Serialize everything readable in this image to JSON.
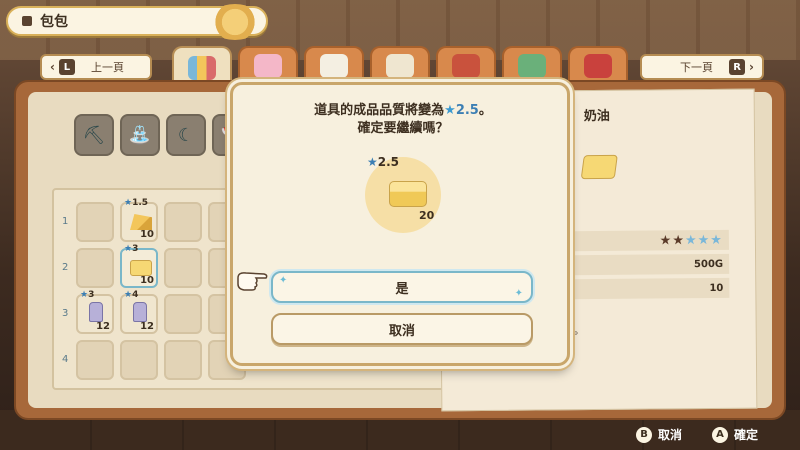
{
  "header": {
    "title": "包包",
    "menu_icon": "menu-list-icon",
    "emblem_icon": "rope-emblem-icon"
  },
  "tabs": {
    "prev": {
      "label": "上一頁",
      "key": "L"
    },
    "next": {
      "label": "下一頁",
      "key": "R"
    },
    "items": [
      {
        "icon": "bag-icon",
        "active": true
      },
      {
        "icon": "gift-icon",
        "active": false
      },
      {
        "icon": "letter-icon",
        "active": false
      },
      {
        "icon": "envelope-icon",
        "active": false
      },
      {
        "icon": "shop-icon",
        "active": false
      },
      {
        "icon": "book-icon",
        "active": false
      },
      {
        "icon": "calendar-icon",
        "active": false
      }
    ]
  },
  "tools": [
    "pickaxe-icon",
    "watering-can-icon",
    "sickle-icon",
    "axe-icon"
  ],
  "grid": {
    "rows": [
      "1",
      "2",
      "3",
      "4"
    ],
    "items": [
      {
        "name": "cheese",
        "grade": "1.5",
        "qty": "10"
      },
      {
        "name": "butter",
        "grade": "3",
        "qty": "10"
      },
      {
        "name": "milk",
        "grade": "3",
        "qty": "12"
      },
      {
        "name": "milk",
        "grade": "4",
        "qty": "12"
      }
    ]
  },
  "detail": {
    "title": "奶油",
    "stars_filled": 2,
    "stars_total": 5,
    "price": "500G",
    "count": "10",
    "dot": "。"
  },
  "dialog": {
    "message_prefix": "道具的成品品質將變為",
    "quality_star": "★",
    "quality_value": "2.5",
    "message_suffix": "。",
    "message_line2": "確定要繼續嗎？",
    "preview_grade": "2.5",
    "preview_qty": "20",
    "yes_label": "是",
    "cancel_label": "取消"
  },
  "footer": {
    "cancel": {
      "key": "B",
      "label": "取消"
    },
    "confirm": {
      "key": "A",
      "label": "確定"
    }
  },
  "colors": {
    "accent_blue": "#3c7fb4",
    "panel_brown": "#a7683a",
    "cream": "#f7f0de"
  }
}
